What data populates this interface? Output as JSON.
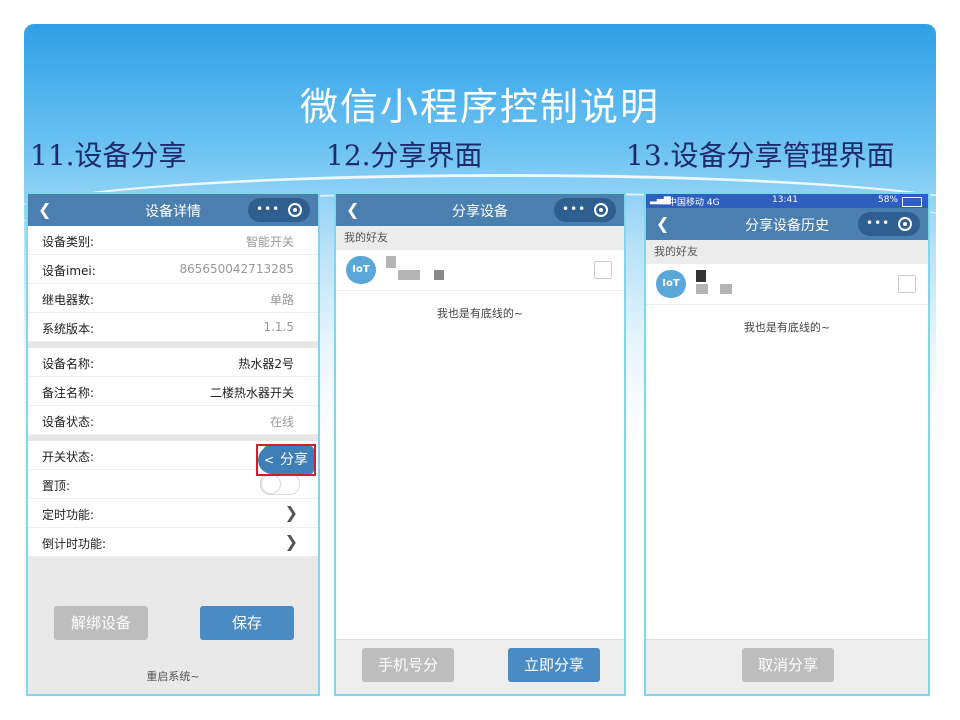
{
  "slide": {
    "title": "微信小程序控制说明",
    "sections": [
      "11.设备分享",
      "12.分享界面",
      "13.设备分享管理界面"
    ]
  },
  "phone1": {
    "nav_title": "设备详情",
    "rows_a": [
      {
        "label": "设备类别:",
        "value": "智能开关"
      },
      {
        "label": "设备imei:",
        "value": "865650042713285"
      },
      {
        "label": "继电器数:",
        "value": "单路"
      },
      {
        "label": "系统版本:",
        "value": "1.1.5"
      }
    ],
    "rows_b": [
      {
        "label": "设备名称:",
        "value": "热水器2号"
      },
      {
        "label": "备注名称:",
        "value": "二楼热水器开关"
      },
      {
        "label": "设备状态:",
        "value": "在线"
      }
    ],
    "rows_c": [
      {
        "label": "开关状态:"
      },
      {
        "label": "置顶:"
      },
      {
        "label": "定时功能:"
      },
      {
        "label": "倒计时功能:"
      }
    ],
    "switch_on": true,
    "pin_on": false,
    "share_float_label": "分享",
    "unbind_label": "解绑设备",
    "save_label": "保存",
    "footer": "重启系统~"
  },
  "phone2": {
    "nav_title": "分享设备",
    "section_label": "我的好友",
    "avatar_text": "IoT",
    "bottom_text": "我也是有底线的~",
    "phone_share_label": "手机号分",
    "share_now_label": "立即分享"
  },
  "phone3": {
    "status_carrier": "中国移动 4G",
    "status_time": "13:41",
    "status_battery": "58%",
    "nav_title": "分享设备历史",
    "section_label": "我的好友",
    "avatar_text": "IoT",
    "bottom_text": "我也是有底线的~",
    "cancel_label": "取消分享"
  },
  "colors": {
    "navbar": "#4a7fb0",
    "primary_button": "#4a8bc4",
    "disabled_button": "#bdbdbd",
    "title_dark": "#1b2b6b",
    "toggle_on": "#2bb24c"
  }
}
